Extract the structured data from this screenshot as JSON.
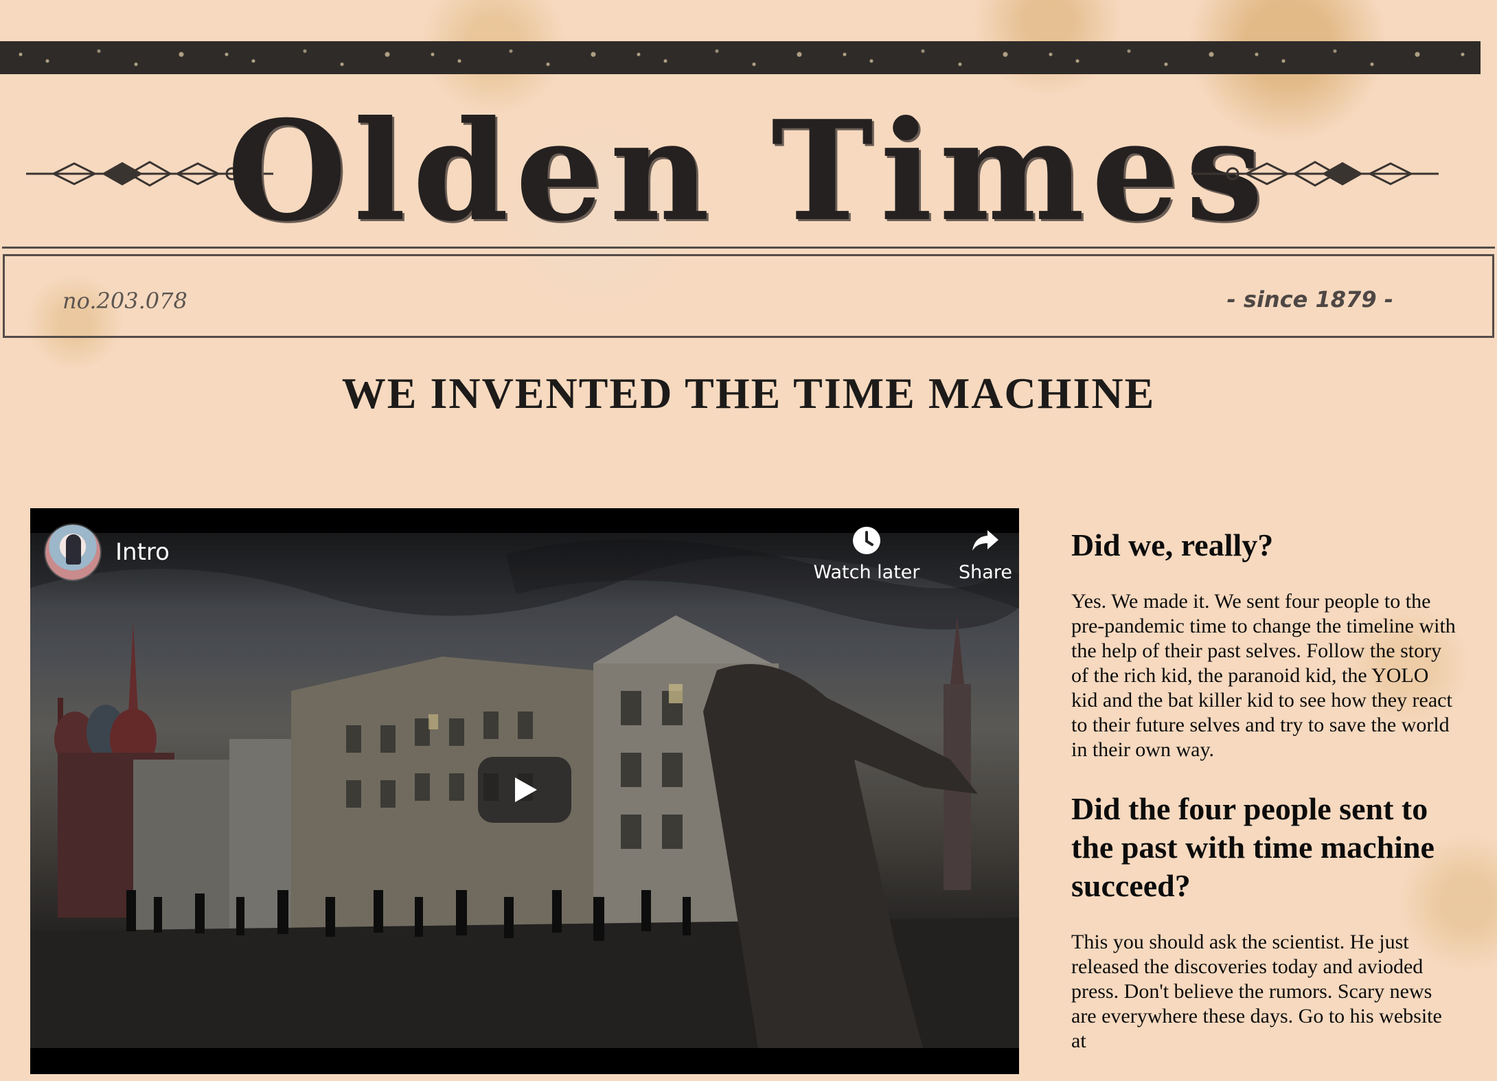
{
  "masthead": {
    "title": "Olden Times",
    "issue_no": "no.203.078",
    "since": "- since 1879 -"
  },
  "headline": "WE INVENTED THE TIME MACHINE",
  "video": {
    "title": "Intro",
    "watch_later_label": "Watch later",
    "share_label": "Share",
    "icons": {
      "avatar": "channel-avatar",
      "watch_later": "clock-icon",
      "share": "share-arrow-icon",
      "play": "play-icon"
    }
  },
  "article": {
    "q1_heading": "Did we, really?",
    "q1_body": "Yes. We made it. We sent four people to the pre-pandemic time to change the timeline with the help of their past selves. Follow the story of the rich kid, the paranoid kid, the YOLO kid and the bat killer kid to see how they react to their future selves and try to save the world in their own way.",
    "q2_heading": "Did the four people sent to the past with time machine succeed?",
    "q2_body": "This you should ask the scientist. He just released the discoveries today and avioded press. Don't believe the rumors. Scary news are everywhere these days. Go to his website at"
  },
  "colors": {
    "paper": "#f6d9bf",
    "ink": "#252120",
    "rule": "#544c48",
    "video_bg": "#000000"
  }
}
